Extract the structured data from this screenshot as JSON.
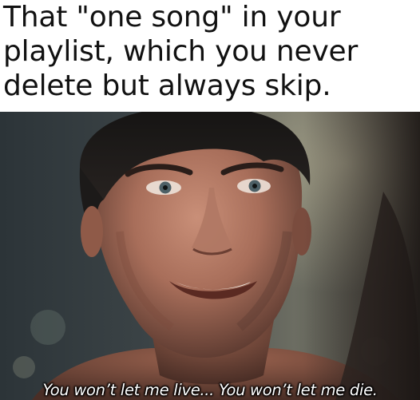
{
  "meme": {
    "caption_lines": [
      "That \"one song\" in your",
      "playlist, which you never",
      "delete but always skip."
    ],
    "subtitle": "You won’t let me live... You won’t let me die."
  },
  "image": {
    "description_icon": "movie-frame-man-smiling"
  }
}
